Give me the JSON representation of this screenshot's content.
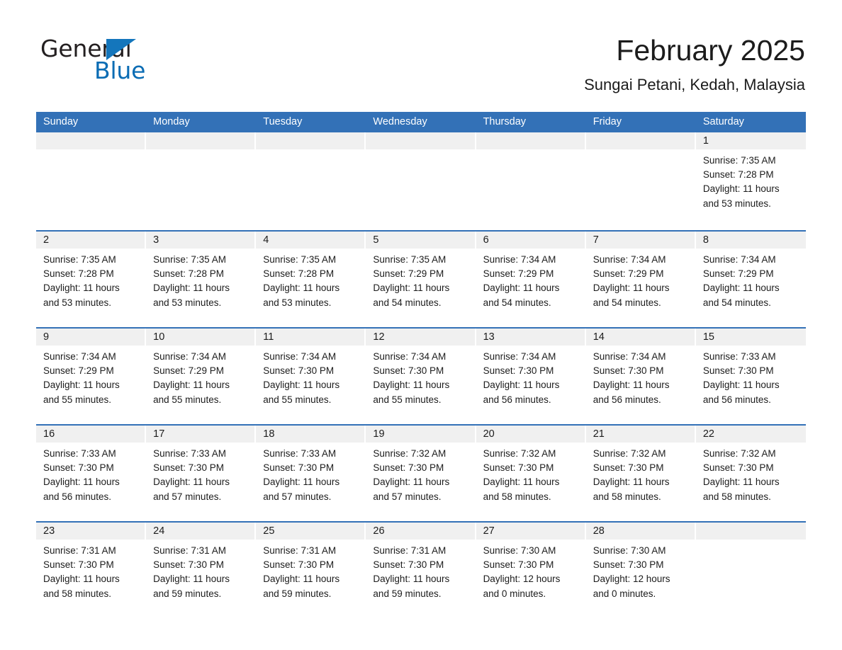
{
  "brand": {
    "name_part1": "General",
    "name_part2": "Blue",
    "triangle_color": "#1476bc",
    "blue_text_color": "#0a6cb4"
  },
  "header": {
    "title": "February 2025",
    "subtitle": "Sungai Petani, Kedah, Malaysia",
    "header_bg_color": "#3371b7",
    "day_band_color": "#f0f0f0"
  },
  "weekdays": [
    "Sunday",
    "Monday",
    "Tuesday",
    "Wednesday",
    "Thursday",
    "Friday",
    "Saturday"
  ],
  "weeks": [
    [
      {
        "day": "",
        "empty": true,
        "sunrise": "",
        "sunset": "",
        "daylight1": "",
        "daylight2": ""
      },
      {
        "day": "",
        "empty": true,
        "sunrise": "",
        "sunset": "",
        "daylight1": "",
        "daylight2": ""
      },
      {
        "day": "",
        "empty": true,
        "sunrise": "",
        "sunset": "",
        "daylight1": "",
        "daylight2": ""
      },
      {
        "day": "",
        "empty": true,
        "sunrise": "",
        "sunset": "",
        "daylight1": "",
        "daylight2": ""
      },
      {
        "day": "",
        "empty": true,
        "sunrise": "",
        "sunset": "",
        "daylight1": "",
        "daylight2": ""
      },
      {
        "day": "",
        "empty": true,
        "sunrise": "",
        "sunset": "",
        "daylight1": "",
        "daylight2": ""
      },
      {
        "day": "1",
        "empty": false,
        "sunrise": "Sunrise: 7:35 AM",
        "sunset": "Sunset: 7:28 PM",
        "daylight1": "Daylight: 11 hours",
        "daylight2": "and 53 minutes."
      }
    ],
    [
      {
        "day": "2",
        "empty": false,
        "sunrise": "Sunrise: 7:35 AM",
        "sunset": "Sunset: 7:28 PM",
        "daylight1": "Daylight: 11 hours",
        "daylight2": "and 53 minutes."
      },
      {
        "day": "3",
        "empty": false,
        "sunrise": "Sunrise: 7:35 AM",
        "sunset": "Sunset: 7:28 PM",
        "daylight1": "Daylight: 11 hours",
        "daylight2": "and 53 minutes."
      },
      {
        "day": "4",
        "empty": false,
        "sunrise": "Sunrise: 7:35 AM",
        "sunset": "Sunset: 7:28 PM",
        "daylight1": "Daylight: 11 hours",
        "daylight2": "and 53 minutes."
      },
      {
        "day": "5",
        "empty": false,
        "sunrise": "Sunrise: 7:35 AM",
        "sunset": "Sunset: 7:29 PM",
        "daylight1": "Daylight: 11 hours",
        "daylight2": "and 54 minutes."
      },
      {
        "day": "6",
        "empty": false,
        "sunrise": "Sunrise: 7:34 AM",
        "sunset": "Sunset: 7:29 PM",
        "daylight1": "Daylight: 11 hours",
        "daylight2": "and 54 minutes."
      },
      {
        "day": "7",
        "empty": false,
        "sunrise": "Sunrise: 7:34 AM",
        "sunset": "Sunset: 7:29 PM",
        "daylight1": "Daylight: 11 hours",
        "daylight2": "and 54 minutes."
      },
      {
        "day": "8",
        "empty": false,
        "sunrise": "Sunrise: 7:34 AM",
        "sunset": "Sunset: 7:29 PM",
        "daylight1": "Daylight: 11 hours",
        "daylight2": "and 54 minutes."
      }
    ],
    [
      {
        "day": "9",
        "empty": false,
        "sunrise": "Sunrise: 7:34 AM",
        "sunset": "Sunset: 7:29 PM",
        "daylight1": "Daylight: 11 hours",
        "daylight2": "and 55 minutes."
      },
      {
        "day": "10",
        "empty": false,
        "sunrise": "Sunrise: 7:34 AM",
        "sunset": "Sunset: 7:29 PM",
        "daylight1": "Daylight: 11 hours",
        "daylight2": "and 55 minutes."
      },
      {
        "day": "11",
        "empty": false,
        "sunrise": "Sunrise: 7:34 AM",
        "sunset": "Sunset: 7:30 PM",
        "daylight1": "Daylight: 11 hours",
        "daylight2": "and 55 minutes."
      },
      {
        "day": "12",
        "empty": false,
        "sunrise": "Sunrise: 7:34 AM",
        "sunset": "Sunset: 7:30 PM",
        "daylight1": "Daylight: 11 hours",
        "daylight2": "and 55 minutes."
      },
      {
        "day": "13",
        "empty": false,
        "sunrise": "Sunrise: 7:34 AM",
        "sunset": "Sunset: 7:30 PM",
        "daylight1": "Daylight: 11 hours",
        "daylight2": "and 56 minutes."
      },
      {
        "day": "14",
        "empty": false,
        "sunrise": "Sunrise: 7:34 AM",
        "sunset": "Sunset: 7:30 PM",
        "daylight1": "Daylight: 11 hours",
        "daylight2": "and 56 minutes."
      },
      {
        "day": "15",
        "empty": false,
        "sunrise": "Sunrise: 7:33 AM",
        "sunset": "Sunset: 7:30 PM",
        "daylight1": "Daylight: 11 hours",
        "daylight2": "and 56 minutes."
      }
    ],
    [
      {
        "day": "16",
        "empty": false,
        "sunrise": "Sunrise: 7:33 AM",
        "sunset": "Sunset: 7:30 PM",
        "daylight1": "Daylight: 11 hours",
        "daylight2": "and 56 minutes."
      },
      {
        "day": "17",
        "empty": false,
        "sunrise": "Sunrise: 7:33 AM",
        "sunset": "Sunset: 7:30 PM",
        "daylight1": "Daylight: 11 hours",
        "daylight2": "and 57 minutes."
      },
      {
        "day": "18",
        "empty": false,
        "sunrise": "Sunrise: 7:33 AM",
        "sunset": "Sunset: 7:30 PM",
        "daylight1": "Daylight: 11 hours",
        "daylight2": "and 57 minutes."
      },
      {
        "day": "19",
        "empty": false,
        "sunrise": "Sunrise: 7:32 AM",
        "sunset": "Sunset: 7:30 PM",
        "daylight1": "Daylight: 11 hours",
        "daylight2": "and 57 minutes."
      },
      {
        "day": "20",
        "empty": false,
        "sunrise": "Sunrise: 7:32 AM",
        "sunset": "Sunset: 7:30 PM",
        "daylight1": "Daylight: 11 hours",
        "daylight2": "and 58 minutes."
      },
      {
        "day": "21",
        "empty": false,
        "sunrise": "Sunrise: 7:32 AM",
        "sunset": "Sunset: 7:30 PM",
        "daylight1": "Daylight: 11 hours",
        "daylight2": "and 58 minutes."
      },
      {
        "day": "22",
        "empty": false,
        "sunrise": "Sunrise: 7:32 AM",
        "sunset": "Sunset: 7:30 PM",
        "daylight1": "Daylight: 11 hours",
        "daylight2": "and 58 minutes."
      }
    ],
    [
      {
        "day": "23",
        "empty": false,
        "sunrise": "Sunrise: 7:31 AM",
        "sunset": "Sunset: 7:30 PM",
        "daylight1": "Daylight: 11 hours",
        "daylight2": "and 58 minutes."
      },
      {
        "day": "24",
        "empty": false,
        "sunrise": "Sunrise: 7:31 AM",
        "sunset": "Sunset: 7:30 PM",
        "daylight1": "Daylight: 11 hours",
        "daylight2": "and 59 minutes."
      },
      {
        "day": "25",
        "empty": false,
        "sunrise": "Sunrise: 7:31 AM",
        "sunset": "Sunset: 7:30 PM",
        "daylight1": "Daylight: 11 hours",
        "daylight2": "and 59 minutes."
      },
      {
        "day": "26",
        "empty": false,
        "sunrise": "Sunrise: 7:31 AM",
        "sunset": "Sunset: 7:30 PM",
        "daylight1": "Daylight: 11 hours",
        "daylight2": "and 59 minutes."
      },
      {
        "day": "27",
        "empty": false,
        "sunrise": "Sunrise: 7:30 AM",
        "sunset": "Sunset: 7:30 PM",
        "daylight1": "Daylight: 12 hours",
        "daylight2": "and 0 minutes."
      },
      {
        "day": "28",
        "empty": false,
        "sunrise": "Sunrise: 7:30 AM",
        "sunset": "Sunset: 7:30 PM",
        "daylight1": "Daylight: 12 hours",
        "daylight2": "and 0 minutes."
      },
      {
        "day": "",
        "empty": true,
        "sunrise": "",
        "sunset": "",
        "daylight1": "",
        "daylight2": ""
      }
    ]
  ]
}
